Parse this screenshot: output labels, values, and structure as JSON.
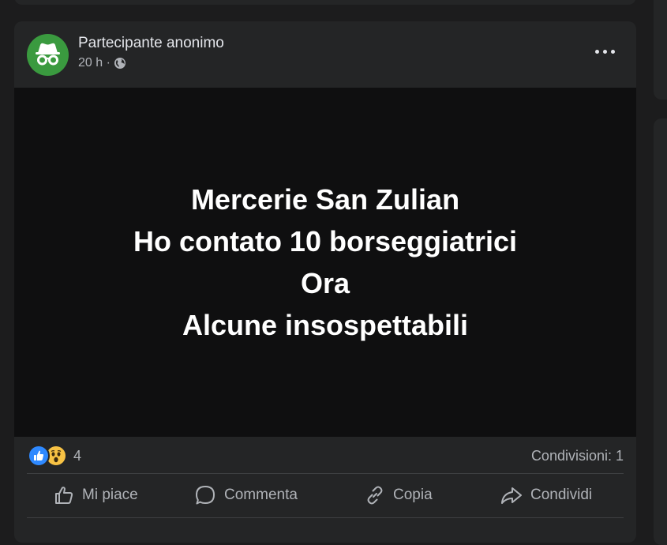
{
  "post": {
    "author": "Partecipante anonimo",
    "time": "20 h ·",
    "privacy_icon": "globe-icon",
    "avatar_icon": "incognito-icon",
    "avatar_color": "#3a9a3f",
    "more_icon": "more-horizontal-icon",
    "text_lines": [
      "Mercerie San Zulian",
      "Ho contato 10 borseggiatrici",
      "Ora",
      "Alcune insospettabili"
    ],
    "reactions": {
      "icons": [
        "like-reaction-icon",
        "wow-reaction-icon"
      ],
      "count": "4"
    },
    "shares": "Condivisioni: 1",
    "actions": [
      {
        "label": "Mi piace",
        "icon": "thumbs-up-icon"
      },
      {
        "label": "Commenta",
        "icon": "comment-icon"
      },
      {
        "label": "Copia",
        "icon": "link-icon"
      },
      {
        "label": "Condividi",
        "icon": "share-icon"
      }
    ]
  },
  "colors": {
    "background": "#1c1c1d",
    "card": "#242526",
    "media_background": "#0f0f10",
    "primary_text": "#e4e6eb",
    "secondary_text": "#b0b3b8",
    "like_blue": "#2e89ff",
    "wow_yellow": "#f7c244"
  }
}
